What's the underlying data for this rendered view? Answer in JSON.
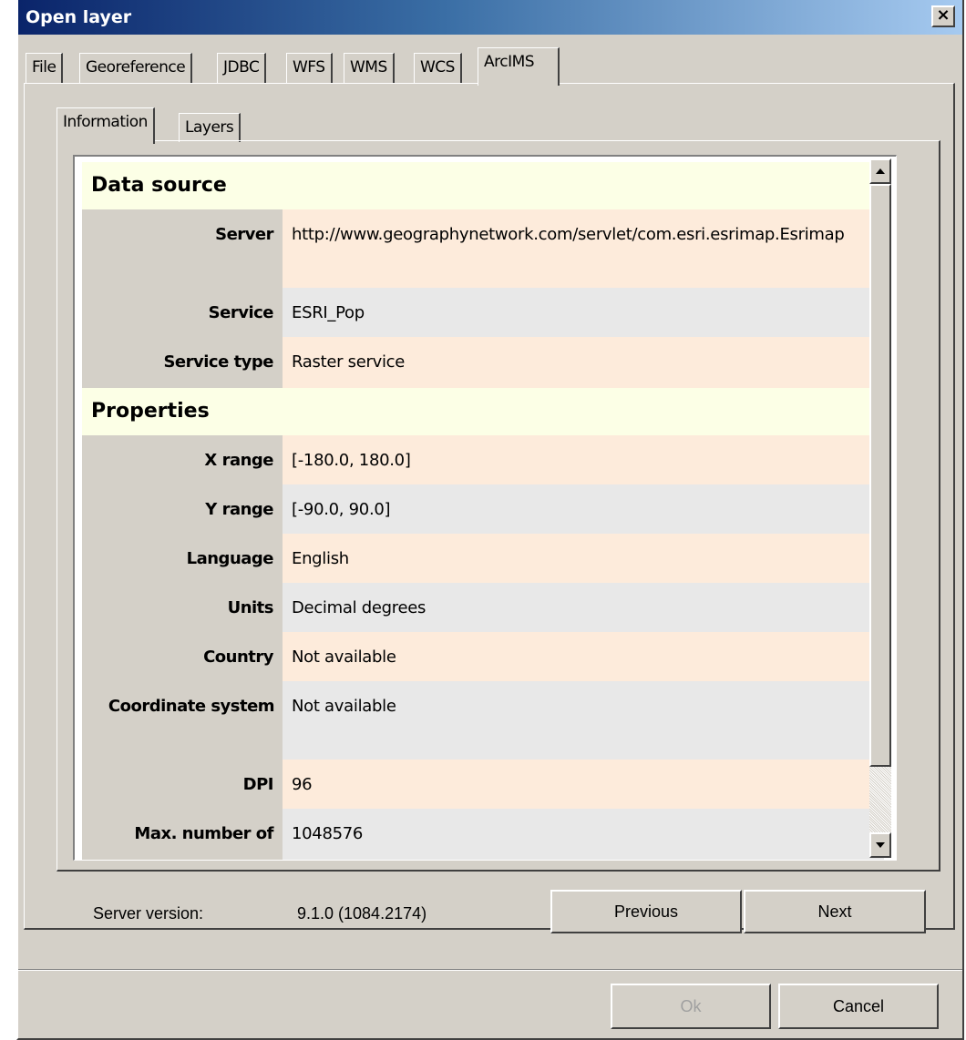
{
  "window": {
    "title": "Open layer",
    "close_label": "×"
  },
  "tabs": [
    "File",
    "Georeference",
    "JDBC",
    "WFS",
    "WMS",
    "WCS",
    "ArcIMS"
  ],
  "subtabs": [
    "Information",
    "Layers"
  ],
  "info": {
    "data_source_header": "Data source",
    "properties_header": "Properties",
    "rows": {
      "server": {
        "label": "Server",
        "value": "http://www.geographynetwork.com/servlet/com.esri.esrimap.Esrimap"
      },
      "service": {
        "label": "Service",
        "value": "ESRI_Pop"
      },
      "service_type": {
        "label": "Service type",
        "value": "Raster service"
      },
      "x_range": {
        "label": "X range",
        "value": "[-180.0, 180.0]"
      },
      "y_range": {
        "label": "Y range",
        "value": "[-90.0, 90.0]"
      },
      "language": {
        "label": "Language",
        "value": "English"
      },
      "units": {
        "label": "Units",
        "value": "Decimal degrees"
      },
      "country": {
        "label": "Country",
        "value": "Not available"
      },
      "coordinate_system": {
        "label": "Coordinate system",
        "value": "Not available"
      },
      "dpi": {
        "label": "DPI",
        "value": "96"
      },
      "max_number": {
        "label": "Max. number of",
        "value": "1048576"
      }
    }
  },
  "footer": {
    "server_version_label": "Server version:",
    "server_version_value": "9.1.0 (1084.2174)",
    "previous_label": "Previous",
    "next_label": "Next",
    "ok_label": "Ok",
    "cancel_label": "Cancel"
  }
}
